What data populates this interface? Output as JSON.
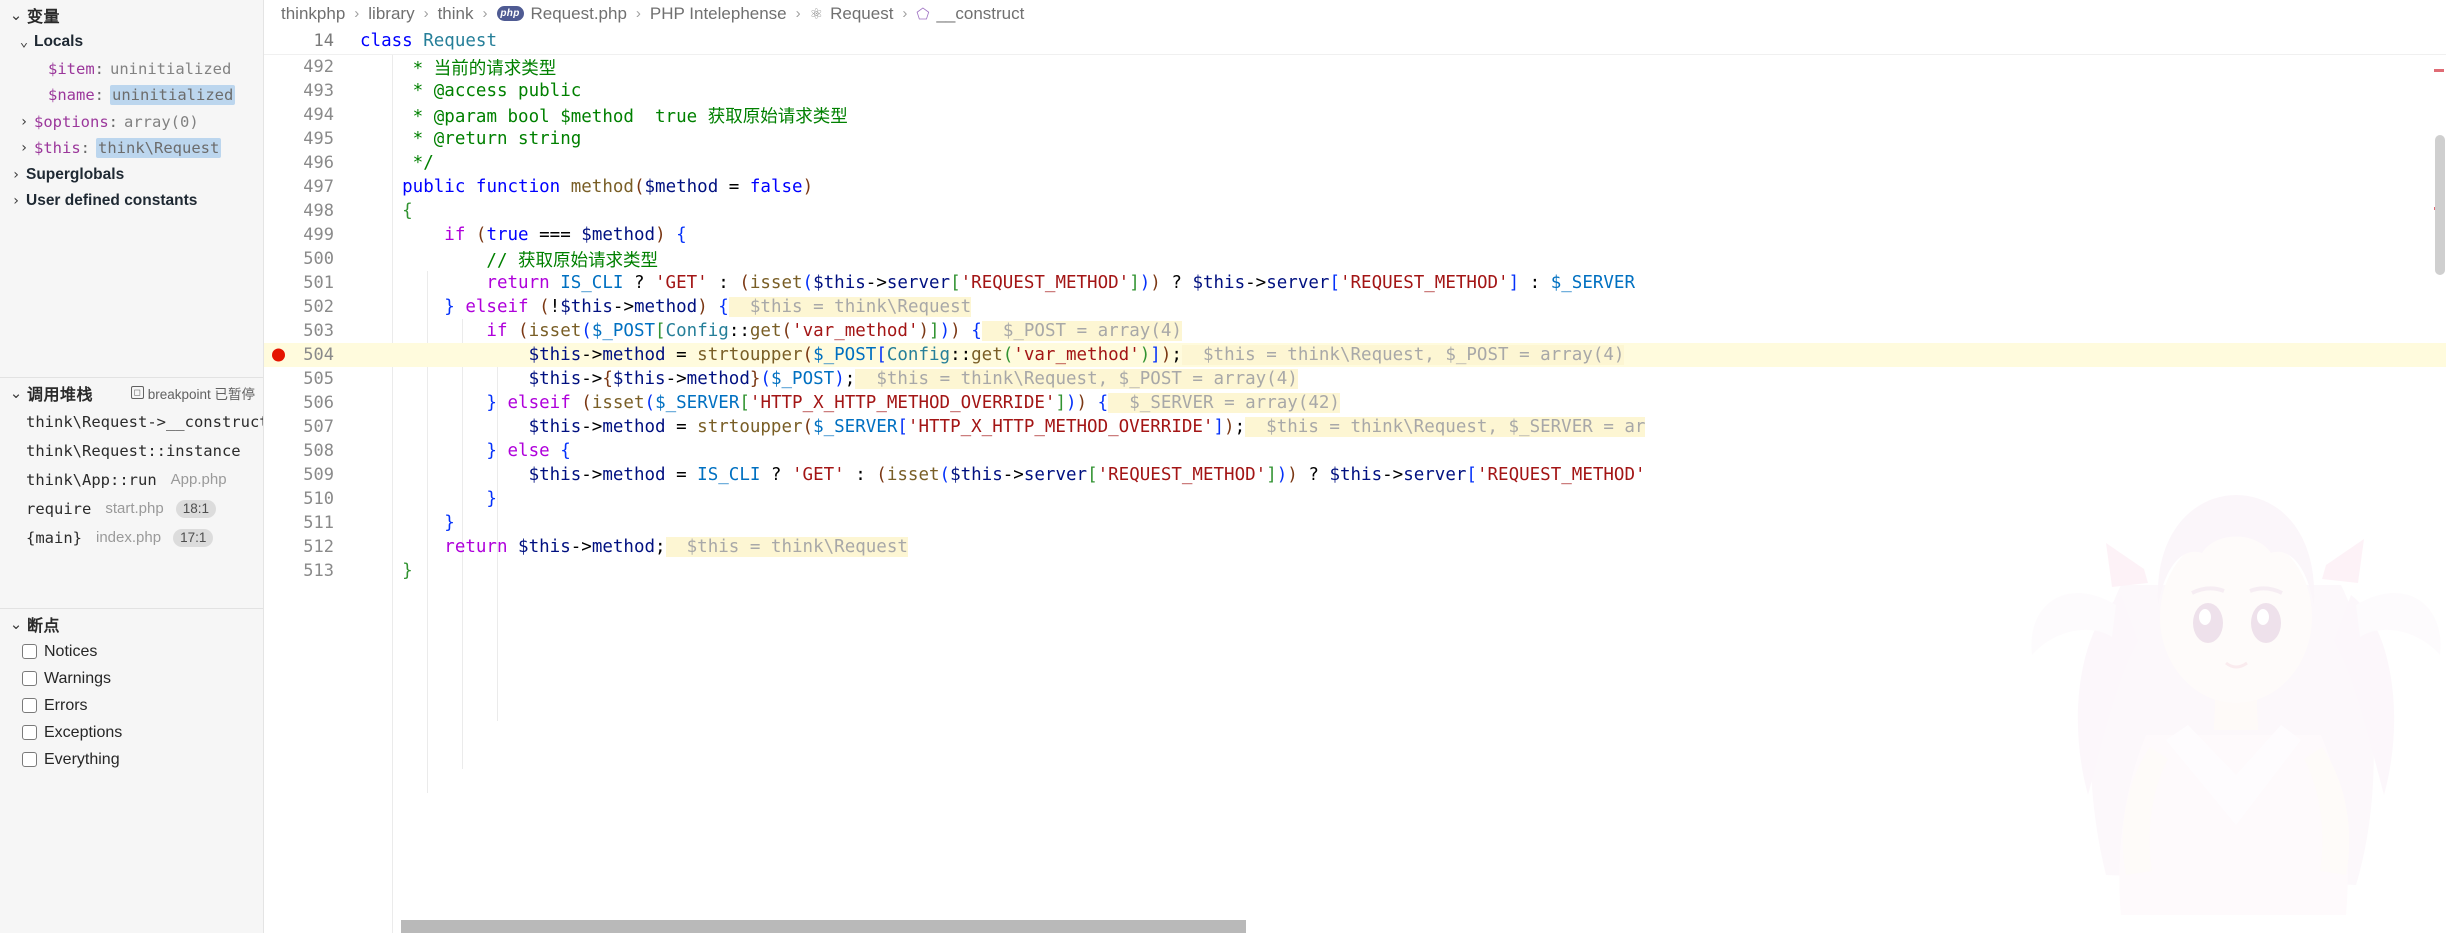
{
  "sidebar": {
    "variables": {
      "title": "变量",
      "chevron": "chevron-down",
      "groups": [
        {
          "label": "Locals",
          "expanded": true
        },
        {
          "label": "Superglobals",
          "expanded": false
        },
        {
          "label": "User defined constants",
          "expanded": false
        }
      ],
      "locals": [
        {
          "name": "$item",
          "sep": ":",
          "value": "uninitialized",
          "highlight": false,
          "expandable": false
        },
        {
          "name": "$name",
          "sep": ":",
          "value": "uninitialized",
          "highlight": true,
          "expandable": false
        },
        {
          "name": "$options",
          "sep": ":",
          "value": "array(0)",
          "highlight": false,
          "expandable": true
        },
        {
          "name": "$this",
          "sep": ":",
          "value": "think\\Request",
          "highlight": true,
          "expandable": true
        }
      ]
    },
    "callstack": {
      "title": "调用堆栈",
      "paused_label": "breakpoint 已暂停",
      "paused_icon": "pause-badge-icon",
      "frames": [
        {
          "fn": "think\\Request->__construct",
          "file": "",
          "pos": ""
        },
        {
          "fn": "think\\Request::instance",
          "file": "",
          "pos": ""
        },
        {
          "fn": "think\\App::run",
          "file": "App.php",
          "pos": ""
        },
        {
          "fn": "require",
          "file": "start.php",
          "pos": "18:1"
        },
        {
          "fn": "{main}",
          "file": "index.php",
          "pos": "17:1"
        }
      ]
    },
    "breakpoints": {
      "title": "断点",
      "items": [
        {
          "label": "Notices",
          "checked": false
        },
        {
          "label": "Warnings",
          "checked": false
        },
        {
          "label": "Errors",
          "checked": false
        },
        {
          "label": "Exceptions",
          "checked": false
        },
        {
          "label": "Everything",
          "checked": false
        }
      ]
    }
  },
  "editor": {
    "breadcrumb": [
      {
        "text": "thinkphp",
        "icon": ""
      },
      {
        "text": "library",
        "icon": ""
      },
      {
        "text": "think",
        "icon": ""
      },
      {
        "text": "Request.php",
        "icon": "php-file-icon"
      },
      {
        "text": "PHP Intelephense",
        "icon": ""
      },
      {
        "text": "Request",
        "icon": "class-icon"
      },
      {
        "text": "__construct",
        "icon": "method-icon"
      }
    ],
    "sticky_line": {
      "number": "14",
      "keyword": "class",
      "name": "Request"
    },
    "breakpoint_line": 504,
    "current_line": 504,
    "lines": [
      {
        "n": 492,
        "segs": [
          {
            "t": "doc",
            "s": "     * "
          },
          {
            "t": "doc",
            "s": "当前的请求类型"
          }
        ]
      },
      {
        "n": 493,
        "segs": [
          {
            "t": "doc",
            "s": "     * "
          },
          {
            "t": "doc",
            "s": "@access public"
          }
        ]
      },
      {
        "n": 494,
        "segs": [
          {
            "t": "doc",
            "s": "     * "
          },
          {
            "t": "doc",
            "s": "@param bool $method  true 获取原始请求类型"
          }
        ]
      },
      {
        "n": 495,
        "segs": [
          {
            "t": "doc",
            "s": "     * "
          },
          {
            "t": "doc",
            "s": "@return string"
          }
        ]
      },
      {
        "n": 496,
        "segs": [
          {
            "t": "doc",
            "s": "     */"
          }
        ]
      },
      {
        "n": 497,
        "segs": [
          {
            "t": "kw",
            "s": "    public "
          },
          {
            "t": "kw",
            "s": "function "
          },
          {
            "t": "fn",
            "s": "method"
          },
          {
            "t": "br3",
            "s": "("
          },
          {
            "t": "var",
            "s": "$method"
          },
          {
            "t": "pl",
            "s": " = "
          },
          {
            "t": "kw",
            "s": "false"
          },
          {
            "t": "br3",
            "s": ")"
          }
        ]
      },
      {
        "n": 498,
        "segs": [
          {
            "t": "br2",
            "s": "    {"
          }
        ]
      },
      {
        "n": 499,
        "segs": [
          {
            "t": "ctl",
            "s": "        if "
          },
          {
            "t": "br3",
            "s": "("
          },
          {
            "t": "kw",
            "s": "true"
          },
          {
            "t": "pl",
            "s": " === "
          },
          {
            "t": "var",
            "s": "$method"
          },
          {
            "t": "br3",
            "s": ")"
          },
          {
            "t": "br1",
            "s": " {"
          }
        ]
      },
      {
        "n": 500,
        "segs": [
          {
            "t": "com",
            "s": "            // 获取原始请求类型"
          }
        ]
      },
      {
        "n": 501,
        "segs": [
          {
            "t": "ctl",
            "s": "            return "
          },
          {
            "t": "const",
            "s": "IS_CLI"
          },
          {
            "t": "pl",
            "s": " ? "
          },
          {
            "t": "str",
            "s": "'GET'"
          },
          {
            "t": "pl",
            "s": " : "
          },
          {
            "t": "br3",
            "s": "("
          },
          {
            "t": "fn",
            "s": "isset"
          },
          {
            "t": "br1",
            "s": "("
          },
          {
            "t": "var",
            "s": "$this"
          },
          {
            "t": "pl",
            "s": "->"
          },
          {
            "t": "var",
            "s": "server"
          },
          {
            "t": "br2",
            "s": "["
          },
          {
            "t": "str",
            "s": "'REQUEST_METHOD'"
          },
          {
            "t": "br2",
            "s": "]"
          },
          {
            "t": "br1",
            "s": ")"
          },
          {
            "t": "br3",
            "s": ")"
          },
          {
            "t": "pl",
            "s": " ? "
          },
          {
            "t": "var",
            "s": "$this"
          },
          {
            "t": "pl",
            "s": "->"
          },
          {
            "t": "var",
            "s": "server"
          },
          {
            "t": "br1",
            "s": "["
          },
          {
            "t": "str",
            "s": "'REQUEST_METHOD'"
          },
          {
            "t": "br1",
            "s": "]"
          },
          {
            "t": "pl",
            "s": " : "
          },
          {
            "t": "const",
            "s": "$_SERVER"
          }
        ]
      },
      {
        "n": 502,
        "segs": [
          {
            "t": "br1",
            "s": "        } "
          },
          {
            "t": "ctl",
            "s": "elseif "
          },
          {
            "t": "br3",
            "s": "("
          },
          {
            "t": "pl",
            "s": "!"
          },
          {
            "t": "var",
            "s": "$this"
          },
          {
            "t": "pl",
            "s": "->"
          },
          {
            "t": "var",
            "s": "method"
          },
          {
            "t": "br3",
            "s": ")"
          },
          {
            "t": "br1",
            "s": " {"
          },
          {
            "t": "inl",
            "s": "  $this = think\\Request"
          }
        ]
      },
      {
        "n": 503,
        "segs": [
          {
            "t": "ctl",
            "s": "            if "
          },
          {
            "t": "br3",
            "s": "("
          },
          {
            "t": "fn",
            "s": "isset"
          },
          {
            "t": "br1",
            "s": "("
          },
          {
            "t": "const",
            "s": "$_POST"
          },
          {
            "t": "br2",
            "s": "["
          },
          {
            "t": "typ",
            "s": "Config"
          },
          {
            "t": "pl",
            "s": "::"
          },
          {
            "t": "fn",
            "s": "get"
          },
          {
            "t": "br3",
            "s": "("
          },
          {
            "t": "str",
            "s": "'var_method'"
          },
          {
            "t": "br3",
            "s": ")"
          },
          {
            "t": "br2",
            "s": "]"
          },
          {
            "t": "br1",
            "s": ")"
          },
          {
            "t": "br3",
            "s": ")"
          },
          {
            "t": "br1",
            "s": " {"
          },
          {
            "t": "inl",
            "s": "  $_POST = array(4)"
          }
        ]
      },
      {
        "n": 504,
        "segs": [
          {
            "t": "var",
            "s": "                $this"
          },
          {
            "t": "pl",
            "s": "->"
          },
          {
            "t": "var",
            "s": "method"
          },
          {
            "t": "pl",
            "s": " = "
          },
          {
            "t": "fn",
            "s": "strtoupper"
          },
          {
            "t": "br3",
            "s": "("
          },
          {
            "t": "const",
            "s": "$_POST"
          },
          {
            "t": "br1",
            "s": "["
          },
          {
            "t": "typ",
            "s": "Config"
          },
          {
            "t": "pl",
            "s": "::"
          },
          {
            "t": "fn",
            "s": "get"
          },
          {
            "t": "br2",
            "s": "("
          },
          {
            "t": "str",
            "s": "'var_method'"
          },
          {
            "t": "br2",
            "s": ")"
          },
          {
            "t": "br1",
            "s": "]"
          },
          {
            "t": "br3",
            "s": ")"
          },
          {
            "t": "pl",
            "s": ";"
          },
          {
            "t": "inl",
            "s": "  $this = think\\Request, $_POST = array(4)"
          }
        ]
      },
      {
        "n": 505,
        "segs": [
          {
            "t": "var",
            "s": "                $this"
          },
          {
            "t": "pl",
            "s": "->"
          },
          {
            "t": "br3",
            "s": "{"
          },
          {
            "t": "var",
            "s": "$this"
          },
          {
            "t": "pl",
            "s": "->"
          },
          {
            "t": "var",
            "s": "method"
          },
          {
            "t": "br3",
            "s": "}"
          },
          {
            "t": "br1",
            "s": "("
          },
          {
            "t": "const",
            "s": "$_POST"
          },
          {
            "t": "br1",
            "s": ")"
          },
          {
            "t": "pl",
            "s": ";"
          },
          {
            "t": "inl",
            "s": "  $this = think\\Request, $_POST = array(4)"
          }
        ]
      },
      {
        "n": 506,
        "segs": [
          {
            "t": "br1",
            "s": "            } "
          },
          {
            "t": "ctl",
            "s": "elseif "
          },
          {
            "t": "br3",
            "s": "("
          },
          {
            "t": "fn",
            "s": "isset"
          },
          {
            "t": "br1",
            "s": "("
          },
          {
            "t": "const",
            "s": "$_SERVER"
          },
          {
            "t": "br2",
            "s": "["
          },
          {
            "t": "str",
            "s": "'HTTP_X_HTTP_METHOD_OVERRIDE'"
          },
          {
            "t": "br2",
            "s": "]"
          },
          {
            "t": "br1",
            "s": ")"
          },
          {
            "t": "br3",
            "s": ")"
          },
          {
            "t": "br1",
            "s": " {"
          },
          {
            "t": "inl",
            "s": "  $_SERVER = array(42)"
          }
        ]
      },
      {
        "n": 507,
        "segs": [
          {
            "t": "var",
            "s": "                $this"
          },
          {
            "t": "pl",
            "s": "->"
          },
          {
            "t": "var",
            "s": "method"
          },
          {
            "t": "pl",
            "s": " = "
          },
          {
            "t": "fn",
            "s": "strtoupper"
          },
          {
            "t": "br3",
            "s": "("
          },
          {
            "t": "const",
            "s": "$_SERVER"
          },
          {
            "t": "br1",
            "s": "["
          },
          {
            "t": "str",
            "s": "'HTTP_X_HTTP_METHOD_OVERRIDE'"
          },
          {
            "t": "br1",
            "s": "]"
          },
          {
            "t": "br3",
            "s": ")"
          },
          {
            "t": "pl",
            "s": ";"
          },
          {
            "t": "inl",
            "s": "  $this = think\\Request, $_SERVER = ar"
          }
        ]
      },
      {
        "n": 508,
        "segs": [
          {
            "t": "br1",
            "s": "            } "
          },
          {
            "t": "ctl",
            "s": "else"
          },
          {
            "t": "br1",
            "s": " {"
          }
        ]
      },
      {
        "n": 509,
        "segs": [
          {
            "t": "var",
            "s": "                $this"
          },
          {
            "t": "pl",
            "s": "->"
          },
          {
            "t": "var",
            "s": "method"
          },
          {
            "t": "pl",
            "s": " = "
          },
          {
            "t": "const",
            "s": "IS_CLI"
          },
          {
            "t": "pl",
            "s": " ? "
          },
          {
            "t": "str",
            "s": "'GET'"
          },
          {
            "t": "pl",
            "s": " : "
          },
          {
            "t": "br3",
            "s": "("
          },
          {
            "t": "fn",
            "s": "isset"
          },
          {
            "t": "br1",
            "s": "("
          },
          {
            "t": "var",
            "s": "$this"
          },
          {
            "t": "pl",
            "s": "->"
          },
          {
            "t": "var",
            "s": "server"
          },
          {
            "t": "br2",
            "s": "["
          },
          {
            "t": "str",
            "s": "'REQUEST_METHOD'"
          },
          {
            "t": "br2",
            "s": "]"
          },
          {
            "t": "br1",
            "s": ")"
          },
          {
            "t": "br3",
            "s": ")"
          },
          {
            "t": "pl",
            "s": " ? "
          },
          {
            "t": "var",
            "s": "$this"
          },
          {
            "t": "pl",
            "s": "->"
          },
          {
            "t": "var",
            "s": "server"
          },
          {
            "t": "br1",
            "s": "["
          },
          {
            "t": "str",
            "s": "'REQUEST_METHOD'"
          }
        ]
      },
      {
        "n": 510,
        "segs": [
          {
            "t": "br1",
            "s": "            }"
          }
        ]
      },
      {
        "n": 511,
        "segs": [
          {
            "t": "br1",
            "s": "        }"
          }
        ]
      },
      {
        "n": 512,
        "segs": [
          {
            "t": "ctl",
            "s": "        return "
          },
          {
            "t": "var",
            "s": "$this"
          },
          {
            "t": "pl",
            "s": "->"
          },
          {
            "t": "var",
            "s": "method"
          },
          {
            "t": "pl",
            "s": ";"
          },
          {
            "t": "inl",
            "s": "  $this = think\\Request"
          }
        ]
      },
      {
        "n": 513,
        "segs": [
          {
            "t": "br2",
            "s": "    }"
          }
        ]
      }
    ]
  },
  "colors": {
    "breakpoint_red": "#e51400",
    "highlight_blue": "#bcd6ee",
    "current_line_bg": "#fffbdd",
    "inline_debug_bg": "#fdf6d3",
    "sidebar_bg": "#f6f6f6"
  }
}
